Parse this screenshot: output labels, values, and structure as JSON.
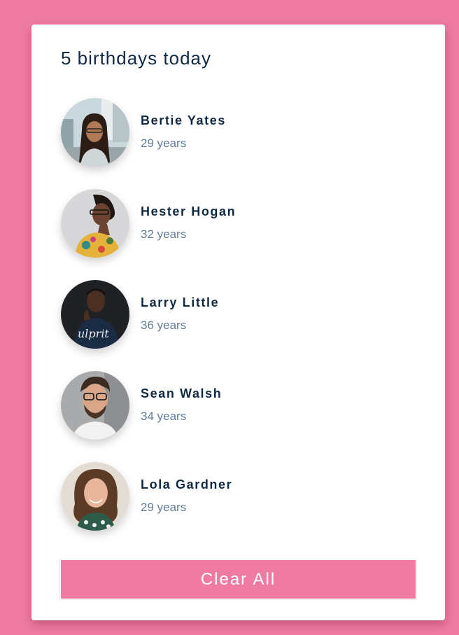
{
  "title": "5 birthdays today",
  "people": [
    {
      "name": "Bertie Yates",
      "age": "29 years"
    },
    {
      "name": "Hester Hogan",
      "age": "32 years"
    },
    {
      "name": "Larry Little",
      "age": "36 years"
    },
    {
      "name": "Sean Walsh",
      "age": "34 years"
    },
    {
      "name": "Lola Gardner",
      "age": "29 years"
    }
  ],
  "clear_button": {
    "label": "Clear All"
  },
  "colors": {
    "background": "#ef7ba3",
    "card": "#ffffff",
    "heading": "#102a43",
    "subtext": "#627d98",
    "button": "#ef7ba3"
  }
}
